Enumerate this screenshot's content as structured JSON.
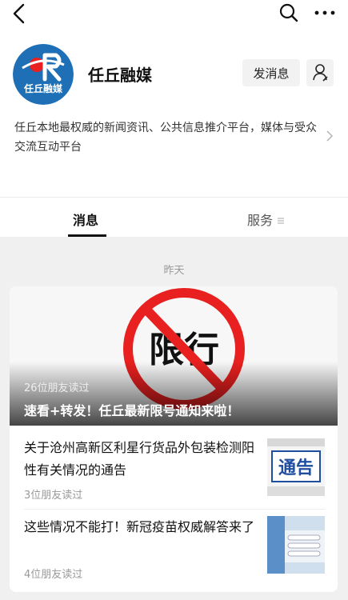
{
  "account": {
    "name": "任丘融媒",
    "logo_text": "任丘融媒",
    "description": "任丘本地最权威的新闻资讯、公共信息推介平台，媒体与受众交流互动平台",
    "message_button": "发消息"
  },
  "tabs": [
    {
      "label": "消息",
      "active": true
    },
    {
      "label": "服务",
      "active": false
    }
  ],
  "feed": {
    "date_label": "昨天",
    "cover": {
      "image_text": "限行",
      "readers": "26位朋友读过",
      "title": "速看+转发！任丘最新限号通知来啦！"
    },
    "items": [
      {
        "title": "关于沧州高新区利星行货品外包装检测阳性有关情况的通告",
        "readers": "3位朋友读过",
        "thumb_text": "通告",
        "thumb": "notice-image"
      },
      {
        "title": "这些情况不能打！新冠疫苗权威解答来了",
        "readers": "4位朋友读过",
        "thumb": "vaccine-image"
      }
    ]
  },
  "colors": {
    "accent": "#e8201f",
    "logo_blue": "#1f6fb6"
  },
  "icons": [
    "back-icon",
    "search-icon",
    "more-icon",
    "profile-icon",
    "chevron-right-icon",
    "menu-icon"
  ]
}
